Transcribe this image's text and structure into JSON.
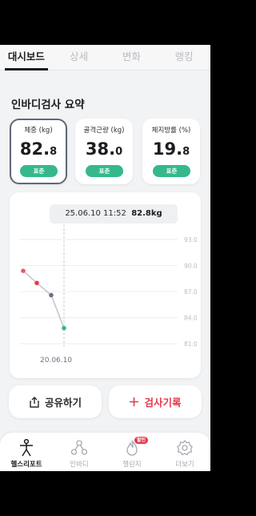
{
  "tabs": [
    {
      "label": "대시보드"
    },
    {
      "label": "상세"
    },
    {
      "label": "변화"
    },
    {
      "label": "랭킹"
    }
  ],
  "section_title": "인바디검사 요약",
  "stats": [
    {
      "label": "체중 (kg)",
      "int": "82.",
      "dec": "8",
      "badge": "표준"
    },
    {
      "label": "골격근량 (kg)",
      "int": "38.",
      "dec": "0",
      "badge": "표준"
    },
    {
      "label": "체지방률 (%)",
      "int": "19.",
      "dec": "8",
      "badge": "표준"
    }
  ],
  "tooltip": {
    "date": "25.06.10 11:52",
    "value": "82.8kg"
  },
  "chart_data": {
    "type": "line",
    "y_ticks": [
      "93.0",
      "90.0",
      "87.0",
      "84.0",
      "81.0"
    ],
    "ylim": [
      81.0,
      93.0
    ],
    "x_label": "20.06.10",
    "values": [
      89.4,
      88.0,
      86.6,
      82.8
    ],
    "point_colors": [
      "#e85a6a",
      "#e23b4d",
      "#6c7380",
      "#35b98a"
    ],
    "grid": true
  },
  "buttons": {
    "share": "공유하기",
    "record": "검사기록"
  },
  "nav": [
    {
      "label": "헬스리포트",
      "icon": "body-icon"
    },
    {
      "label": "인바디",
      "icon": "inbody-icon"
    },
    {
      "label": "챌린지",
      "icon": "flame-icon",
      "badge": "할인"
    },
    {
      "label": "더보기",
      "icon": "gear-icon"
    }
  ],
  "colors": {
    "accent_green": "#35b98a",
    "accent_red": "#e23b4d"
  }
}
